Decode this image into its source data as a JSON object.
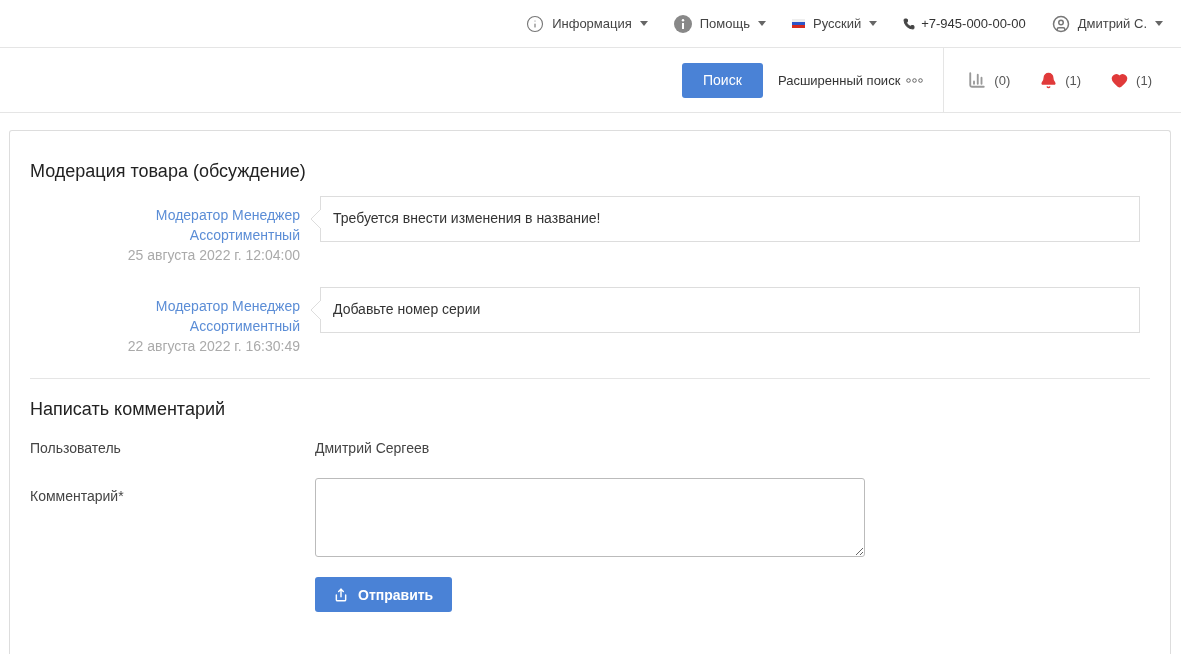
{
  "top_bar": {
    "menus": [
      {
        "kind": "info",
        "label": "Информация"
      },
      {
        "kind": "help",
        "label": "Помощь"
      },
      {
        "kind": "language",
        "label": "Русский"
      }
    ],
    "phone": "+7-945-000-00-00",
    "user": "Дмитрий С."
  },
  "search_bar": {
    "search_button": "Поиск",
    "advanced_search": "Расширенный поиск",
    "counters": [
      {
        "kind": "compare",
        "count": "(0)"
      },
      {
        "kind": "notifications",
        "count": "(1)"
      },
      {
        "kind": "favorites",
        "count": "(1)"
      }
    ]
  },
  "discussion": {
    "title": "Модерация товара (обсуждение)",
    "messages": [
      {
        "author": "Модератор Менеджер Ассортиментный",
        "date": "25 августа 2022 г. 12:04:00",
        "text": "Требуется внести изменения в название!"
      },
      {
        "author": "Модератор Менеджер Ассортиментный",
        "date": "22 августа 2022 г. 16:30:49",
        "text": "Добавьте номер серии"
      }
    ]
  },
  "comment_form": {
    "title": "Написать комментарий",
    "user_label": "Пользователь",
    "user_value": "Дмитрий Сергеев",
    "comment_label": "Комментарий*",
    "submit": "Отправить"
  }
}
